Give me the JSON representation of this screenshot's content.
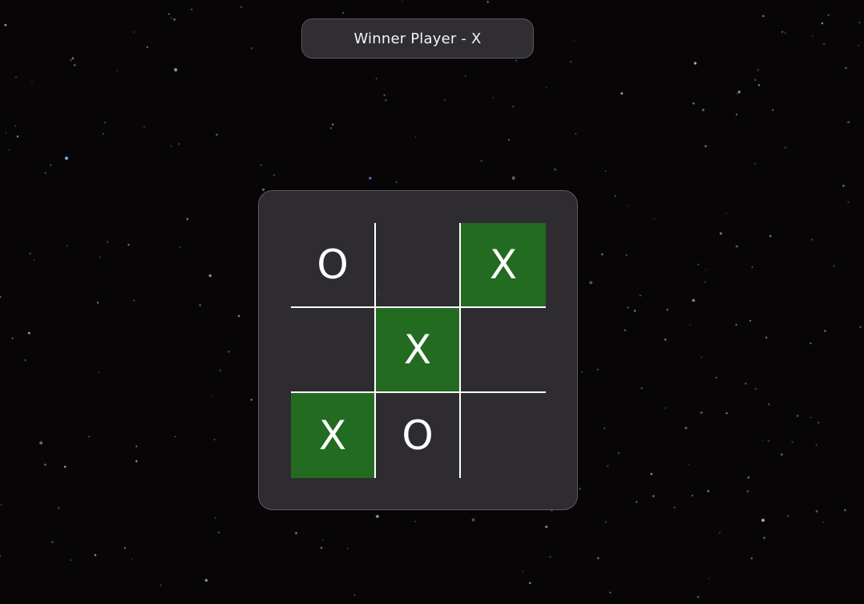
{
  "status": {
    "text": "Winner Player - X"
  },
  "board": {
    "cells": [
      {
        "mark": "O",
        "winning": false
      },
      {
        "mark": "",
        "winning": false
      },
      {
        "mark": "X",
        "winning": true
      },
      {
        "mark": "",
        "winning": false
      },
      {
        "mark": "X",
        "winning": true
      },
      {
        "mark": "",
        "winning": false
      },
      {
        "mark": "X",
        "winning": true
      },
      {
        "mark": "O",
        "winning": false
      },
      {
        "mark": "",
        "winning": false
      }
    ]
  },
  "colors": {
    "background": "#070506",
    "panel": "#302e32",
    "win_highlight": "#226b21",
    "grid_lines": "#ffffff",
    "mark": "#ffffff"
  }
}
